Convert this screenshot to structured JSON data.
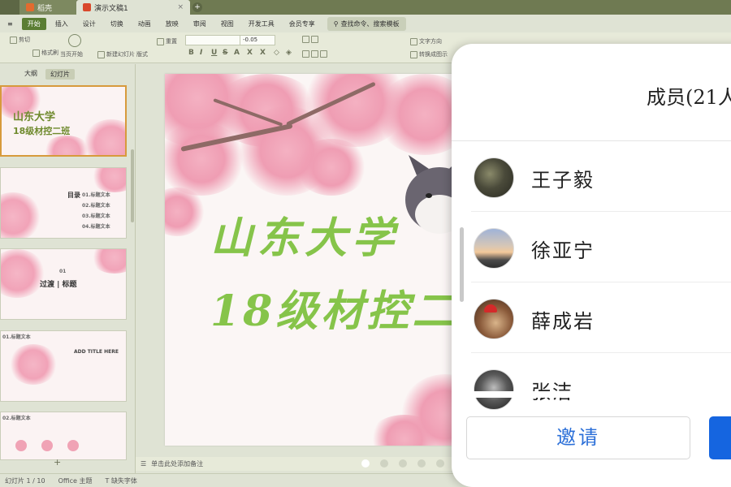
{
  "titlebar": {
    "tabs": [
      {
        "label": "稻壳"
      },
      {
        "label": "演示文稿1"
      }
    ],
    "new_tab": "+"
  },
  "ribbon": {
    "tabs": [
      "开始",
      "插入",
      "设计",
      "切换",
      "动画",
      "放映",
      "审阅",
      "视图",
      "开发工具",
      "会员专享"
    ],
    "active_tab": "开始",
    "search_placeholder": "查找命令、搜索模板",
    "buttons": {
      "cut": "剪切",
      "format_painter": "格式刷",
      "play_from_current": "当页开始",
      "new_slide": "新建幻灯片",
      "layout": "版式",
      "reset": "重置",
      "font_size_value": "-0.05",
      "text_dir": "文字方向",
      "convert_smartart": "转换成图示"
    }
  },
  "left_panel": {
    "tabs": [
      "大纲",
      "幻灯片"
    ],
    "active_tab": "幻灯片",
    "slides": [
      {
        "title": "山东大学",
        "subtitle": "18级材控二班"
      },
      {
        "title": "目录",
        "items": [
          "01.标题文本",
          "02.标题文本",
          "03.标题文本",
          "04.标题文本"
        ]
      },
      {
        "title": "过渡 | 标题",
        "num": "01"
      },
      {
        "title": "ADD TITLE HERE",
        "label": "01.标题文本"
      },
      {
        "label": "02.标题文本"
      }
    ],
    "add_slide": "+"
  },
  "slide": {
    "title_line1": "山东大学",
    "title_line2": "18级材控二"
  },
  "notes": {
    "placeholder": "单击此处添加备注"
  },
  "statusbar": {
    "slide_counter": "幻灯片 1 / 10",
    "theme": "Office 主题",
    "missing_font": "缺失字体"
  },
  "overlay": {
    "title": "成员(21人",
    "members": [
      {
        "name": "王子毅"
      },
      {
        "name": "徐亚宁"
      },
      {
        "name": "薛成岩"
      },
      {
        "name": "张洁"
      }
    ],
    "invite_button": "邀请"
  }
}
